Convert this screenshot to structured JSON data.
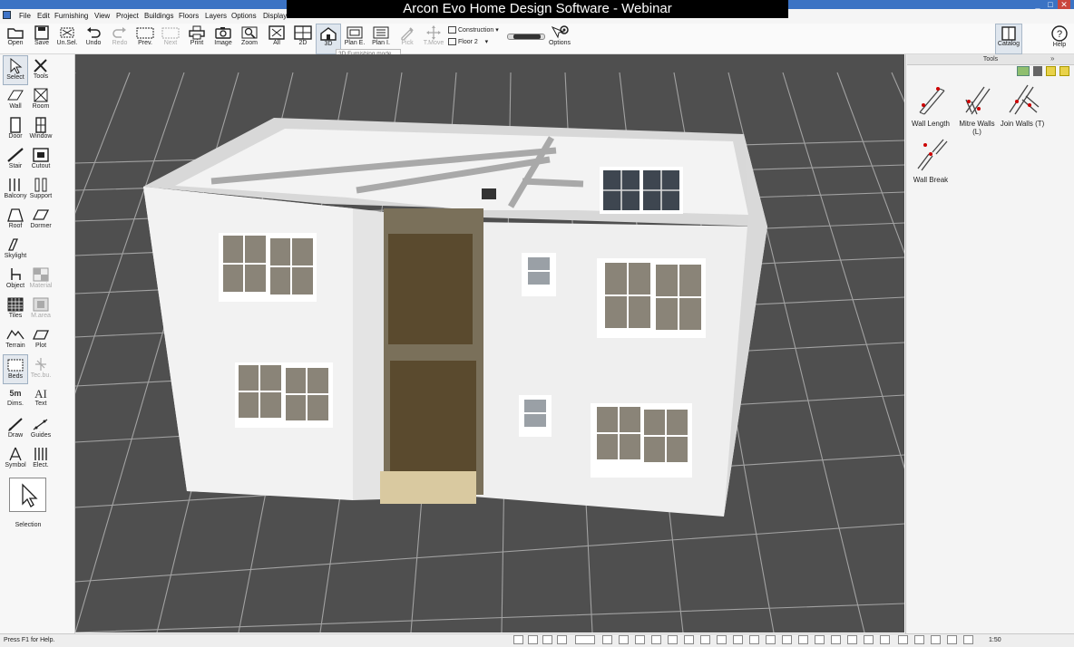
{
  "window": {
    "overlay_title": "Arcon Evo Home Design Software - Webinar",
    "controls": [
      "_",
      "□",
      "✕"
    ]
  },
  "menu": {
    "items": [
      "File",
      "Edit",
      "Furnishing",
      "View",
      "Project",
      "Buildings",
      "Floors",
      "Layers",
      "Options",
      "Display"
    ]
  },
  "toolbar": {
    "open": "Open",
    "save": "Save",
    "unsel": "Un.Sel.",
    "undo": "Undo",
    "redo": "Redo",
    "prev": "Prev.",
    "next": "Next",
    "print": "Print",
    "image": "Image",
    "zoom": "Zoom",
    "all": "All",
    "mode_2d": "2D",
    "mode_3d": "3D",
    "plan_e": "Plan E.",
    "plan_i": "Plan I.",
    "pick": "Pick",
    "t_move": "T.Move",
    "construction": "Construction",
    "floor": "Floor 2",
    "options": "Options",
    "catalog": "Catalog",
    "help": "Help",
    "tooltip": "3D Furnishing mode"
  },
  "left_tools": {
    "select": "Select",
    "tools": "Tools",
    "wall": "Wall",
    "room": "Room",
    "door": "Door",
    "window": "Window",
    "stair": "Stair",
    "cutout": "Cutout",
    "balcony": "Balcony",
    "support": "Support",
    "roof": "Roof",
    "dormer": "Dormer",
    "skylight": "Skylight",
    "object": "Object",
    "material": "Material",
    "tiles": "Tiles",
    "m_area": "M.area",
    "terrain": "Terrain",
    "plot": "Plot",
    "beds": "Beds",
    "tec_bu": "Tec.bu.",
    "dims": "Dims.",
    "dims_icon": "5m",
    "text": "Text",
    "text_icon": "AI",
    "draw": "Draw",
    "guides": "Guides",
    "symbol": "Symbol",
    "elect": "Elect.",
    "selection": "Selection"
  },
  "right_panel": {
    "header": "Tools",
    "wall_length": "Wall Length",
    "mitre_walls_1": "Mitre Walls",
    "mitre_walls_2": "(L)",
    "join_walls": "Join Walls (T)",
    "wall_break": "Wall Break"
  },
  "status": {
    "help_text": "Press F1 for Help.",
    "scale": "1:50"
  },
  "colors": {
    "title_blue": "#3b73c4",
    "viewport_grid": "#4c4c4c",
    "wall_white": "#f1f1f1",
    "door_brown": "#5a4a2e"
  }
}
